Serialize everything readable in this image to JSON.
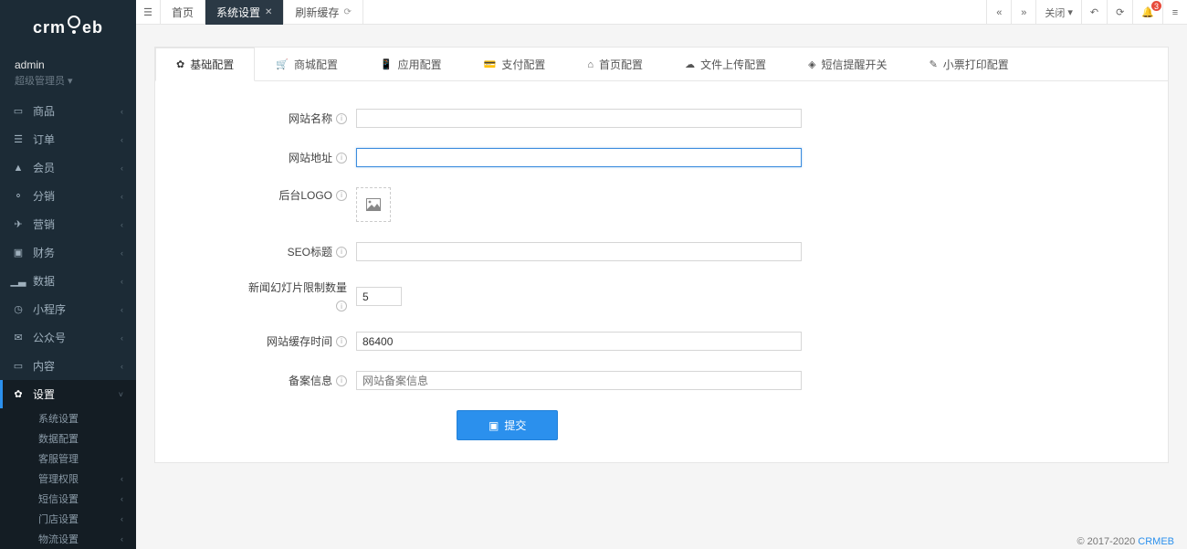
{
  "brand": "crmeb",
  "user": {
    "name": "admin",
    "role": "超级管理员"
  },
  "sidebar": {
    "items": [
      {
        "icon": "laptop",
        "label": "商品"
      },
      {
        "icon": "list",
        "label": "订单"
      },
      {
        "icon": "user",
        "label": "会员"
      },
      {
        "icon": "share",
        "label": "分销"
      },
      {
        "icon": "send",
        "label": "营销"
      },
      {
        "icon": "money",
        "label": "财务"
      },
      {
        "icon": "chart",
        "label": "数据"
      },
      {
        "icon": "dashboard",
        "label": "小程序"
      },
      {
        "icon": "wechat",
        "label": "公众号"
      },
      {
        "icon": "picture",
        "label": "内容"
      },
      {
        "icon": "gear",
        "label": "设置",
        "active": true
      }
    ],
    "sub": [
      {
        "label": "系统设置",
        "chev": false
      },
      {
        "label": "数据配置",
        "chev": false
      },
      {
        "label": "客服管理",
        "chev": false
      },
      {
        "label": "管理权限",
        "chev": true
      },
      {
        "label": "短信设置",
        "chev": true
      },
      {
        "label": "门店设置",
        "chev": true
      },
      {
        "label": "物流设置",
        "chev": true
      }
    ]
  },
  "topTabs": [
    {
      "label": "首页",
      "kind": "home"
    },
    {
      "label": "系统设置",
      "kind": "active"
    },
    {
      "label": "刷新缓存",
      "kind": "refresh"
    }
  ],
  "topRight": {
    "closeLabel": "关闭",
    "badge": "3"
  },
  "configTabs": [
    {
      "icon": "gear",
      "label": "基础配置",
      "active": true
    },
    {
      "icon": "cart",
      "label": "商城配置"
    },
    {
      "icon": "phone",
      "label": "应用配置"
    },
    {
      "icon": "card",
      "label": "支付配置"
    },
    {
      "icon": "home",
      "label": "首页配置"
    },
    {
      "icon": "cloud",
      "label": "文件上传配置"
    },
    {
      "icon": "rss",
      "label": "短信提醒开关"
    },
    {
      "icon": "print",
      "label": "小票打印配置"
    }
  ],
  "form": {
    "siteName": {
      "label": "网站名称",
      "value": ""
    },
    "siteUrl": {
      "label": "网站地址",
      "value": ""
    },
    "adminLogo": {
      "label": "后台LOGO"
    },
    "seoTitle": {
      "label": "SEO标题",
      "value": ""
    },
    "slideLimit": {
      "label": "新闻幻灯片限制数量",
      "value": "5"
    },
    "cacheTime": {
      "label": "网站缓存时间",
      "value": "86400"
    },
    "beian": {
      "label": "备案信息",
      "value": "",
      "placeholder": "网站备案信息"
    },
    "submit": "提交"
  },
  "footer": {
    "text": "© 2017-2020 ",
    "link": "CRMEB"
  }
}
